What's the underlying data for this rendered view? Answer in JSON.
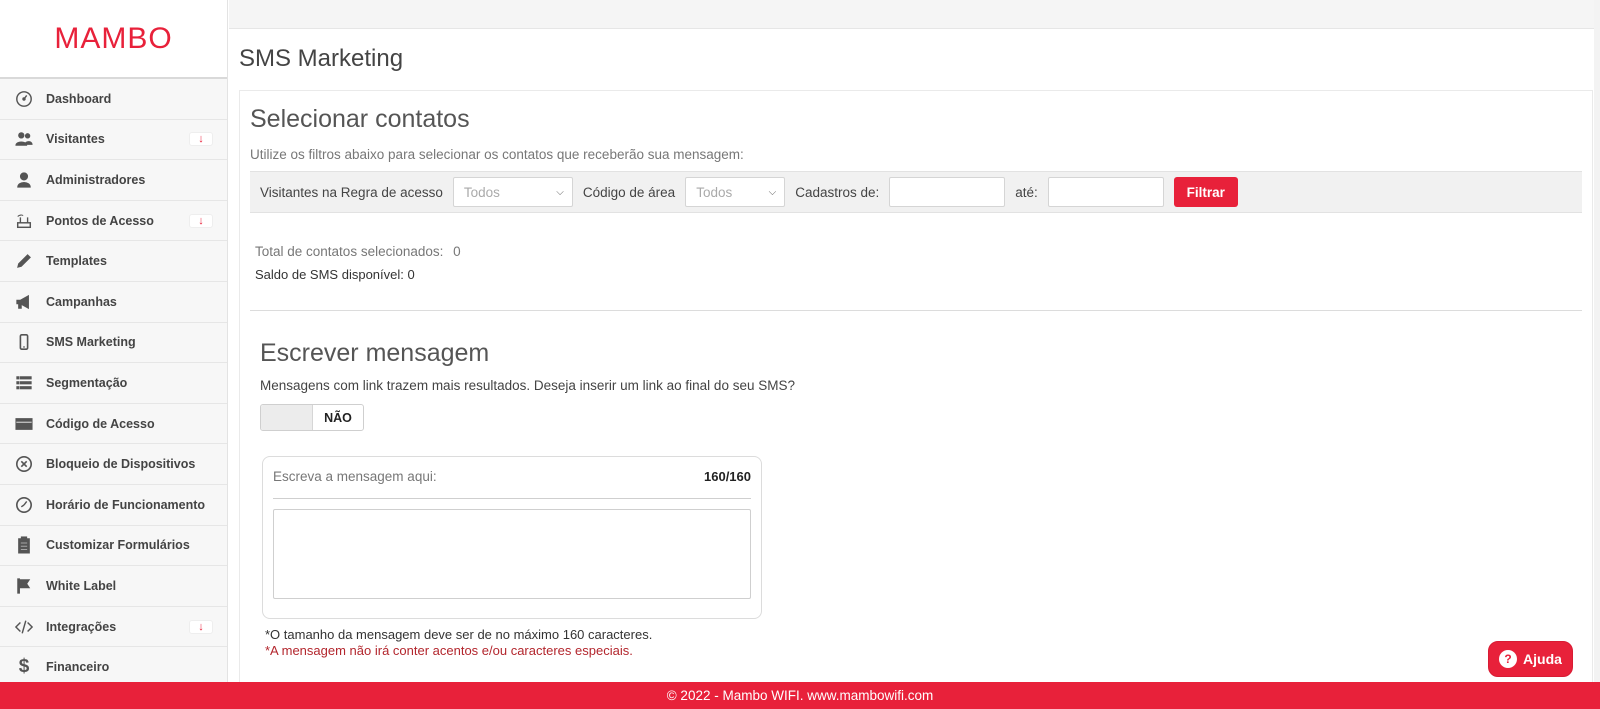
{
  "brand": {
    "logo_text": "MAMBO",
    "accent_color": "#e8213a"
  },
  "sidebar": {
    "items": [
      {
        "label": "Dashboard",
        "icon": "dashboard-gauge-icon",
        "expandable": false
      },
      {
        "label": "Visitantes",
        "icon": "users-icon",
        "expandable": true
      },
      {
        "label": "Administradores",
        "icon": "user-icon",
        "expandable": false
      },
      {
        "label": "Pontos de Acesso",
        "icon": "router-icon",
        "expandable": true
      },
      {
        "label": "Templates",
        "icon": "pencil-icon",
        "expandable": false
      },
      {
        "label": "Campanhas",
        "icon": "megaphone-icon",
        "expandable": false
      },
      {
        "label": "SMS Marketing",
        "icon": "mobile-phone-icon",
        "expandable": false
      },
      {
        "label": "Segmentação",
        "icon": "list-icon",
        "expandable": false
      },
      {
        "label": "Código de Acesso",
        "icon": "credit-card-icon",
        "expandable": false
      },
      {
        "label": "Bloqueio de Dispositivos",
        "icon": "block-circle-icon",
        "expandable": false
      },
      {
        "label": "Horário de Funcionamento",
        "icon": "clock-icon",
        "expandable": false
      },
      {
        "label": "Customizar Formulários",
        "icon": "clipboard-icon",
        "expandable": false
      },
      {
        "label": "White Label",
        "icon": "flag-icon",
        "expandable": false
      },
      {
        "label": "Integrações",
        "icon": "code-icon",
        "expandable": true
      },
      {
        "label": "Financeiro",
        "icon": "dollar-icon",
        "expandable": false
      }
    ],
    "expand_arrow": "↓"
  },
  "page": {
    "title": "SMS Marketing"
  },
  "contacts": {
    "title": "Selecionar contatos",
    "description": "Utilize os filtros abaixo para selecionar os contatos que receberão sua mensagem:",
    "filters": {
      "rule_label": "Visitantes na Regra de acesso",
      "rule_value": "Todos",
      "area_label": "Código de área",
      "area_value": "Todos",
      "from_label": "Cadastros de:",
      "to_label": "até:",
      "filter_button": "Filtrar"
    },
    "total_label": "Total de contatos selecionados:",
    "total_value": "0",
    "saldo": "Saldo de SMS disponível: 0"
  },
  "message": {
    "title": "Escrever mensagem",
    "link_question": "Mensagens com link trazem mais resultados. Deseja inserir um link ao final do seu SMS?",
    "link_toggle": "NÃO",
    "placeholder": "Escreva a mensagem aqui:",
    "counter": "160/160",
    "note_length": "*O tamanho da mensagem deve ser de no máximo 160 caracteres.",
    "note_accents": "*A mensagem não irá conter acentos e/ou caracteres especiais."
  },
  "help": {
    "label": "Ajuda",
    "icon": "question-icon"
  },
  "footer": {
    "text": "© 2022 - Mambo WIFI. www.mambowifi.com"
  }
}
